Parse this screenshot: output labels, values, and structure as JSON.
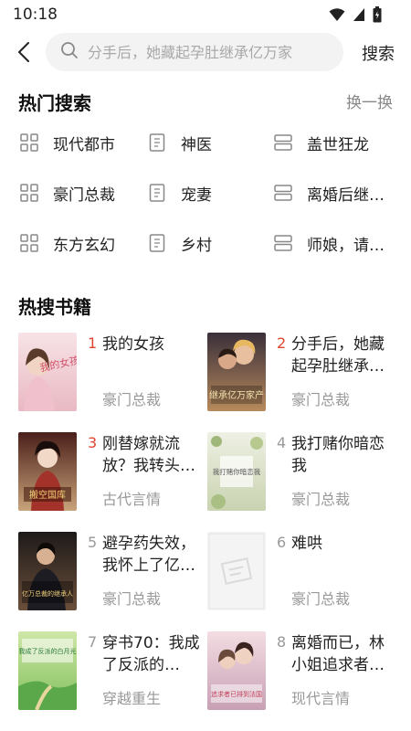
{
  "status": {
    "time": "10:18"
  },
  "search": {
    "placeholder": "分手后，她藏起孕肚继承亿万家",
    "button": "搜索"
  },
  "hot_search": {
    "title": "热门搜索",
    "refresh": "换一换",
    "items": [
      {
        "label": "现代都市",
        "icon": "grid-icon"
      },
      {
        "label": "神医",
        "icon": "book-icon"
      },
      {
        "label": "盖世狂龙",
        "icon": "list-icon"
      },
      {
        "label": "豪门总裁",
        "icon": "grid-icon"
      },
      {
        "label": "宠妻",
        "icon": "book-icon"
      },
      {
        "label": "离婚后继…",
        "icon": "list-icon"
      },
      {
        "label": "东方玄幻",
        "icon": "grid-icon"
      },
      {
        "label": "乡村",
        "icon": "book-icon"
      },
      {
        "label": "师娘，请…",
        "icon": "list-icon"
      }
    ]
  },
  "hot_books": {
    "title": "热搜书籍",
    "books": [
      {
        "rank": "1",
        "title": "我的女孩",
        "tag": "豪门总裁",
        "cover_text": "我的女孩",
        "colors": [
          "#f7e3e6",
          "#e9b9c3"
        ]
      },
      {
        "rank": "2",
        "title": "分手后，她藏起孕肚继承…",
        "tag": "豪门总裁",
        "cover_text": "继承亿万家产",
        "colors": [
          "#3a2f3a",
          "#b78a5c"
        ]
      },
      {
        "rank": "3",
        "title": "刚替嫁就流放？我转头…",
        "tag": "古代言情",
        "cover_text": "搬空国库",
        "colors": [
          "#4a1f1a",
          "#c9a47a"
        ]
      },
      {
        "rank": "4",
        "title": "我打赌你暗恋我",
        "tag": "豪门总裁",
        "cover_text": "我打赌你暗恋我",
        "colors": [
          "#eef0e4",
          "#c9d3b0"
        ]
      },
      {
        "rank": "5",
        "title": "避孕药失效，我怀上了亿…",
        "tag": "豪门总裁",
        "cover_text": "亿万总裁的继承人",
        "colors": [
          "#1e1a1a",
          "#6b4f3a"
        ]
      },
      {
        "rank": "6",
        "title": "难哄",
        "tag": "豪门总裁",
        "cover_text": "",
        "colors": [
          "#f4f4f4",
          "#e2e2e2"
        ]
      },
      {
        "rank": "7",
        "title": "穿书70：我成了反派的…",
        "tag": "穿越重生",
        "cover_text": "我成了反派的白月光",
        "colors": [
          "#cfe7a8",
          "#7fbf5a"
        ]
      },
      {
        "rank": "8",
        "title": "离婚而已，林小姐追求者…",
        "tag": "现代言情",
        "cover_text": "追求者已排到法国",
        "colors": [
          "#f3dde2",
          "#c8a0b5"
        ]
      }
    ]
  }
}
